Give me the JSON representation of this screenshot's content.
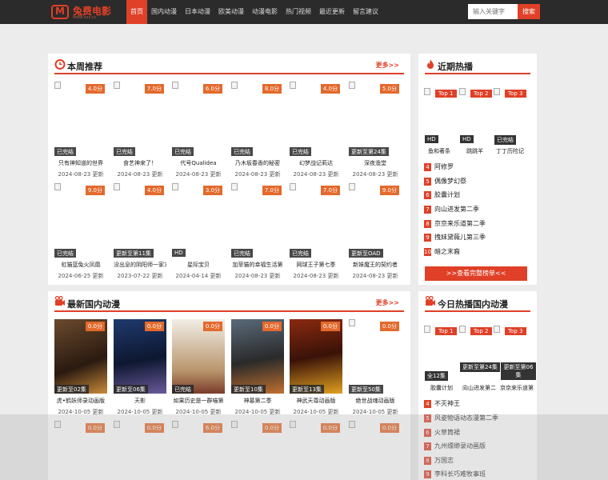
{
  "logo": {
    "mark": "M",
    "name": "兔费电影",
    "url": "www.xxx.cc"
  },
  "nav": [
    "首页",
    "国内动漫",
    "日本动漫",
    "欧美动漫",
    "动漫电影",
    "热门视频",
    "最近更新",
    "留言建议"
  ],
  "search": {
    "placeholder": "输入关键字",
    "button": "搜索"
  },
  "weekly": {
    "title": "本周推荐",
    "more": "更多>>",
    "items": [
      {
        "score": "4.0分",
        "status": "已完结",
        "title": "只有神知道的世界",
        "date": "2024-08-23 更新"
      },
      {
        "score": "7.0分",
        "status": "已完结",
        "title": "食艺神来了！",
        "date": "2024-08-23 更新"
      },
      {
        "score": "6.0分",
        "status": "已完结",
        "title": "代号Qualidea",
        "date": "2024-08-23 更新"
      },
      {
        "score": "8.0分",
        "status": "已完结",
        "title": "乃木坂春香的秘密",
        "date": "2024-08-23 更新"
      },
      {
        "score": "4.0分",
        "status": "已完结",
        "title": "幻梦战记莉达",
        "date": "2024-08-23 更新"
      },
      {
        "score": "5.0分",
        "status": "更新至第24集",
        "title": "深夜渔堂",
        "date": "2024-08-23 更新"
      },
      {
        "score": "9.0分",
        "status": "已完结",
        "title": "虹猫蓝兔火凤凰",
        "date": "2024-06-25 更新"
      },
      {
        "score": "4.0分",
        "status": "更新至第11集",
        "title": "没出息的阴阳师一家3",
        "date": "2023-07-22 更新"
      },
      {
        "score": "3.0分",
        "status": "HD",
        "title": "星际宝贝",
        "date": "2024-04-14 更新"
      },
      {
        "score": "7.0分",
        "status": "已完结",
        "title": "加菲猫的幸福生活第",
        "date": "2024-08-23 更新"
      },
      {
        "score": "7.0分",
        "status": "已完结",
        "title": "网球王子第七季",
        "date": "2024-08-23 更新"
      },
      {
        "score": "9.0分",
        "status": "更新至OAD",
        "title": "新妹魔王的契约者",
        "date": "2024-08-23 更新"
      }
    ]
  },
  "latest": {
    "title": "最新国内动漫",
    "more": "更多>>",
    "items": [
      {
        "score": "0.0分",
        "status": "更新至02集",
        "title": "虎•鹤妖师录动画版",
        "date": "2024-10-05 更新"
      },
      {
        "score": "0.0分",
        "status": "更新至06集",
        "title": "天影",
        "date": "2024-10-05 更新"
      },
      {
        "score": "0.0分",
        "status": "已完结",
        "title": "如果历史是一群喵第",
        "date": "2024-10-05 更新"
      },
      {
        "score": "0.0分",
        "status": "更新至10集",
        "title": "神墓第二季",
        "date": "2024-10-05 更新"
      },
      {
        "score": "0.0分",
        "status": "更新至13集",
        "title": "神武天尊动画版",
        "date": "2024-10-05 更新"
      },
      {
        "score": "0.0分",
        "status": "更新至50集",
        "title": "绝世战魂动画版",
        "date": "2024-10-05 更新"
      },
      {
        "score": "0.0分"
      },
      {
        "score": "0.0分"
      },
      {
        "score": "6.0分"
      },
      {
        "score": "0.0分"
      },
      {
        "score": "0.0分"
      },
      {
        "score": "0.0分"
      }
    ]
  },
  "hot": {
    "title": "近期热播",
    "tops": [
      "Top 1",
      "Top 2",
      "Top 3"
    ],
    "top_items": [
      {
        "badge": "HD",
        "name": "鱼和著条"
      },
      {
        "badge": "HD",
        "name": "跳跳羊"
      },
      {
        "badge": "已完结",
        "name": "丁丁历险记"
      }
    ],
    "rank": [
      {
        "n": "4",
        "name": "阿修罗"
      },
      {
        "n": "5",
        "name": "偶像梦幻祭"
      },
      {
        "n": "6",
        "name": "胶囊计划"
      },
      {
        "n": "7",
        "name": "向山进发第二季"
      },
      {
        "n": "8",
        "name": "京京来乐道第二季"
      },
      {
        "n": "9",
        "name": "拽妹黛薇儿第三季"
      },
      {
        "n": "10",
        "name": "暗之末裔"
      }
    ],
    "button": ">>查看完整榜单<<"
  },
  "today": {
    "title": "今日热播国内动漫",
    "tops": [
      "Top 1",
      "Top 2",
      "Top 3"
    ],
    "top_items": [
      {
        "badge": "全12集",
        "name": "胶囊计划"
      },
      {
        "badge": "更新至第24集",
        "name": "向山进发第二"
      },
      {
        "badge": "更新至第06集",
        "name": "京京来乐道第"
      }
    ],
    "rank": [
      {
        "n": "4",
        "name": "不灭神王"
      },
      {
        "n": "5",
        "name": "风姿物语动态漫第二季"
      },
      {
        "n": "6",
        "name": "火草筒裙"
      },
      {
        "n": "7",
        "name": "九州缥缈录动画版"
      },
      {
        "n": "8",
        "name": "万国志"
      },
      {
        "n": "9",
        "name": "李科长巧难牧事班"
      }
    ]
  },
  "colors": {
    "accent": "#e04027",
    "topbar": "#2b2b2b",
    "score": "#e36a2c"
  }
}
